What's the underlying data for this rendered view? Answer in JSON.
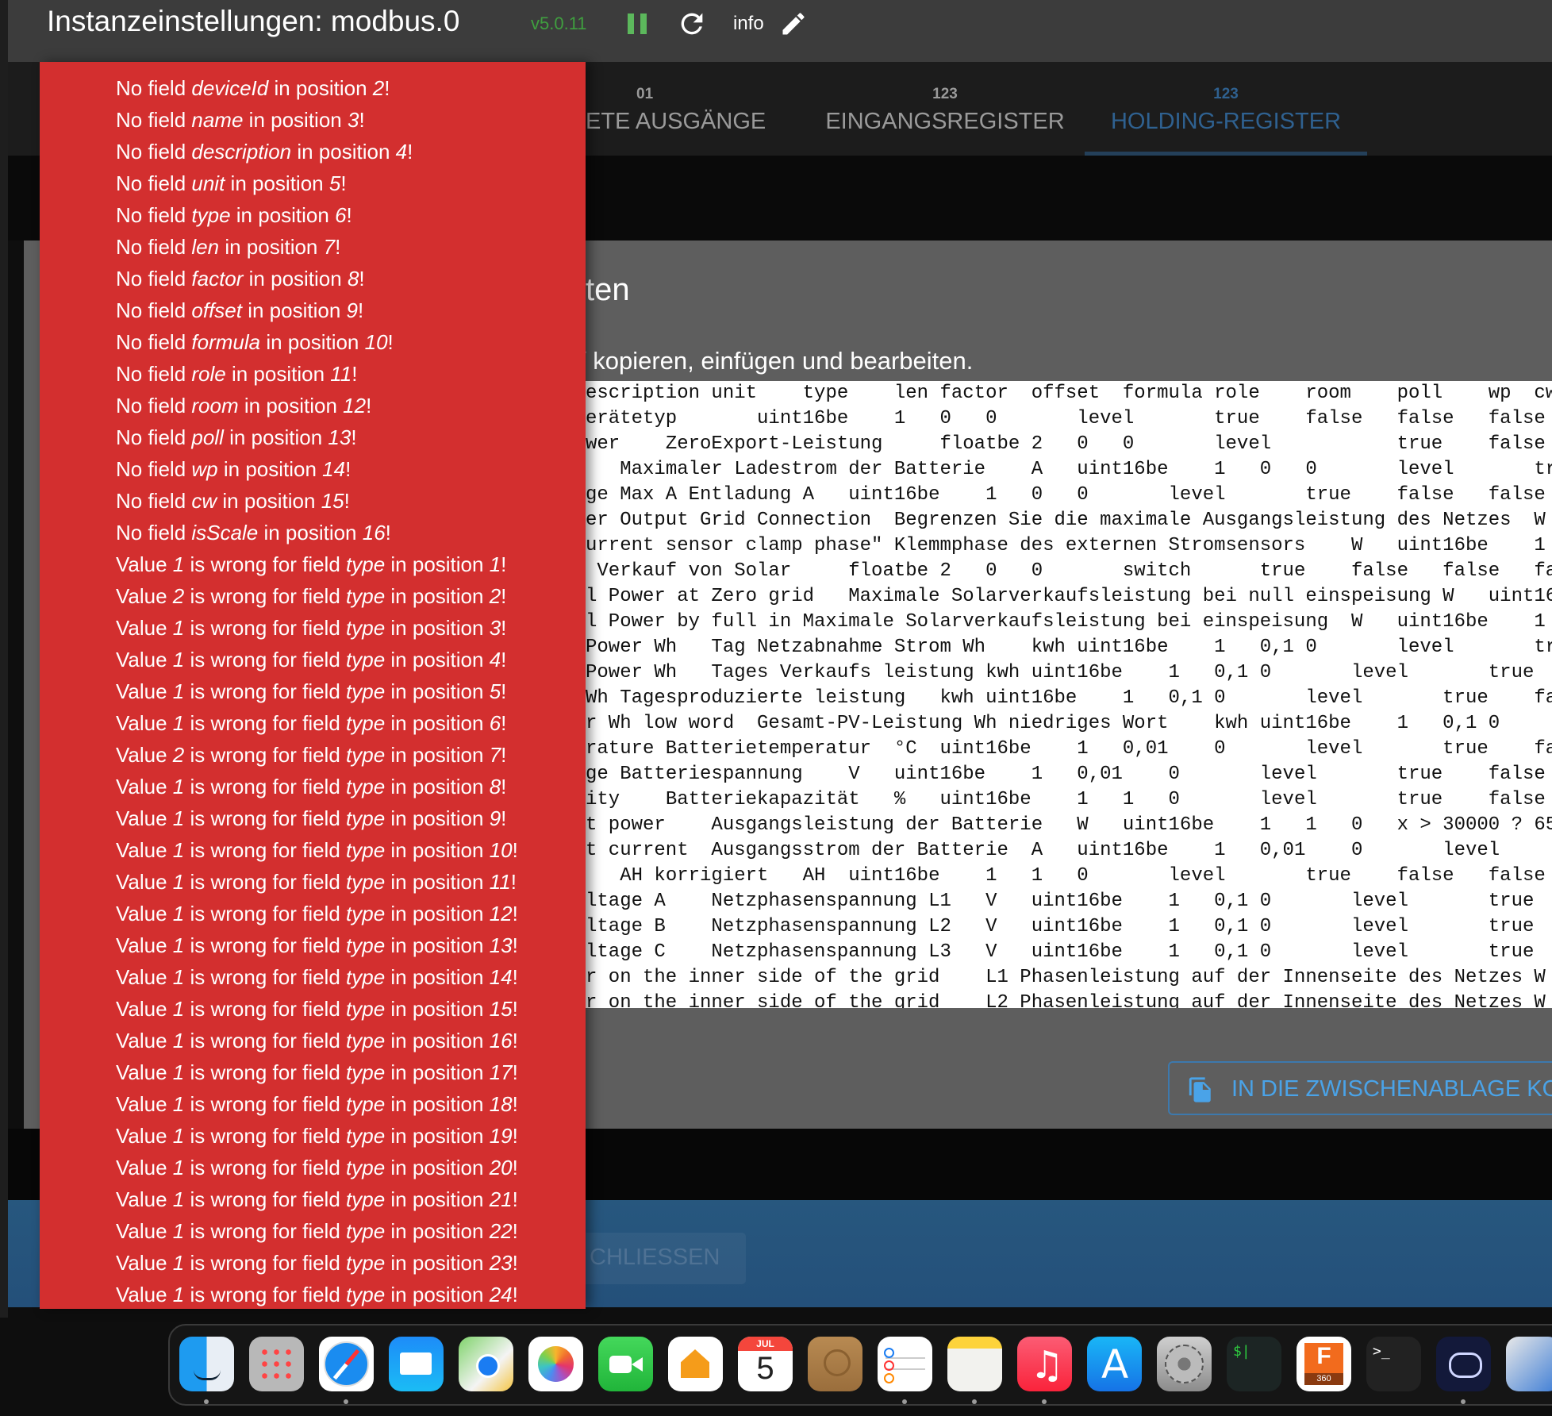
{
  "header": {
    "title": "Instanzeinstellungen: modbus.0",
    "version": "v5.0.11",
    "info_label": "info",
    "version_color": "#3f9f3f",
    "pause_color": "#5cb85c"
  },
  "tabs": [
    {
      "small": "01",
      "label": "ETE AUSGÄNGE",
      "active": false
    },
    {
      "small": "123",
      "label": "EINGANGSREGISTER",
      "active": false
    },
    {
      "small": "123",
      "label": "HOLDING-REGISTER",
      "active": true
    }
  ],
  "dialog": {
    "title": "ten",
    "subtitle": "/ kopieren, einfügen und bearbeiten.",
    "copy_button": "IN DIE ZWISCHENABLAGE KO",
    "close_button": "CHLIESSEN",
    "tsv_lines": [
      "escription unit\ttype\tlen factor\toffset\tformula\trole\troom\tpoll\twp\tcw",
      "erätetyp\t\tuint16be\t1\t0\t0\t\tlevel\t\ttrue\tfalse\tfalse\tfalse",
      "wer\tZeroExport-Leistung\t\tfloatbe\t2\t0\t0\t\tlevel\t\t\ttrue\tfalse\tfa",
      "\tMaximaler Ladestrom der Batterie\tA\tuint16be\t1\t0\t0\t\tlevel\t\ttr",
      "ge Max A Entladung A\tuint16be\t1\t0\t0\t\tlevel\t\ttrue\tfalse\tfalse",
      "er Output Grid Connection\tBegrenzen Sie die maximale Ausgangsleistung des Netzes\tW",
      "urrent sensor clamp phase\" Klemmphase des externen Stromsensors\tW\tuint16be\t1",
      " Verkauf von Solar\t\tfloatbe\t2\t0\t0\t\tswitch\t\ttrue\tfalse\tfalse\tfa",
      "l Power at Zero grid\tMaximale Solarverkaufsleistung bei null einspeisung\tW\tuint16",
      "l Power by full in Maximale Solarverkaufsleistung bei einspeisung\tW\tuint16be\t1",
      "Power Wh\tTag Netzabnahme Strom Wh\tkwh\tuint16be\t1\t0,1\t0\t\tlevel\t\ttr",
      "Power Wh\tTages Verkaufs leistung\tkwh\tuint16be\t1\t0,1\t0\t\tlevel\t\ttrue",
      "Wh\tTagesproduzierte leistung\tkwh\tuint16be\t1\t0,1\t0\t\tlevel\t\ttrue\tfa",
      "r Wh low word\tGesamt-PV-Leistung Wh niedriges Wort\tkwh\tuint16be\t1\t0,1\t0",
      "rature Batterietemperatur\t°C\tuint16be\t1\t0,01\t0\t\tlevel\t\ttrue\tfa",
      "ge\tBatteriespannung\tV\tuint16be\t1\t0,01\t0\t\tlevel\t\ttrue\tfalse",
      "ity\tBatteriekapazität\t%\tuint16be\t1\t1\t0\t\tlevel\t\ttrue\tfalse",
      "t power\tAusgangsleistung der Batterie\tW\tuint16be\t1\t1\t0\tx > 30000 ? 65",
      "t current\tAusgangsstrom der Batterie\tA\tuint16be\t1\t0,01\t0\t\tlevel",
      "\tAH korrigiert\tAH\tuint16be\t1\t1\t0\t\tlevel\t\ttrue\tfalse\tfalse",
      "ltage A\tNetzphasenspannung L1\tV\tuint16be\t1\t0,1\t0\t\tlevel\t\ttrue",
      "ltage B\tNetzphasenspannung L2\tV\tuint16be\t1\t0,1\t0\t\tlevel\t\ttrue",
      "ltage C\tNetzphasenspannung L3\tV\tuint16be\t1\t0,1\t0\t\tlevel\t\ttrue",
      "r on the inner side of the grid\tL1 Phasenleistung auf der Innenseite des Netzes\tW",
      "r on the inner side of the grid\tL2 Phasenleistung auf der Innenseite des Netzes\tW"
    ]
  },
  "errors": {
    "color": "#d32f2f",
    "missing_fields": [
      {
        "field": "deviceId",
        "position": "2"
      },
      {
        "field": "name",
        "position": "3"
      },
      {
        "field": "description",
        "position": "4"
      },
      {
        "field": "unit",
        "position": "5"
      },
      {
        "field": "type",
        "position": "6"
      },
      {
        "field": "len",
        "position": "7"
      },
      {
        "field": "factor",
        "position": "8"
      },
      {
        "field": "offset",
        "position": "9"
      },
      {
        "field": "formula",
        "position": "10"
      },
      {
        "field": "role",
        "position": "11"
      },
      {
        "field": "room",
        "position": "12"
      },
      {
        "field": "poll",
        "position": "13"
      },
      {
        "field": "wp",
        "position": "14"
      },
      {
        "field": "cw",
        "position": "15"
      },
      {
        "field": "isScale",
        "position": "16"
      }
    ],
    "wrong_values": [
      {
        "value": "1",
        "field": "type",
        "position": "1"
      },
      {
        "value": "2",
        "field": "type",
        "position": "2"
      },
      {
        "value": "1",
        "field": "type",
        "position": "3"
      },
      {
        "value": "1",
        "field": "type",
        "position": "4"
      },
      {
        "value": "1",
        "field": "type",
        "position": "5"
      },
      {
        "value": "1",
        "field": "type",
        "position": "6"
      },
      {
        "value": "2",
        "field": "type",
        "position": "7"
      },
      {
        "value": "1",
        "field": "type",
        "position": "8"
      },
      {
        "value": "1",
        "field": "type",
        "position": "9"
      },
      {
        "value": "1",
        "field": "type",
        "position": "10"
      },
      {
        "value": "1",
        "field": "type",
        "position": "11"
      },
      {
        "value": "1",
        "field": "type",
        "position": "12"
      },
      {
        "value": "1",
        "field": "type",
        "position": "13"
      },
      {
        "value": "1",
        "field": "type",
        "position": "14"
      },
      {
        "value": "1",
        "field": "type",
        "position": "15"
      },
      {
        "value": "1",
        "field": "type",
        "position": "16"
      },
      {
        "value": "1",
        "field": "type",
        "position": "17"
      },
      {
        "value": "1",
        "field": "type",
        "position": "18"
      },
      {
        "value": "1",
        "field": "type",
        "position": "19"
      },
      {
        "value": "1",
        "field": "type",
        "position": "20"
      },
      {
        "value": "1",
        "field": "type",
        "position": "21"
      },
      {
        "value": "1",
        "field": "type",
        "position": "22"
      },
      {
        "value": "1",
        "field": "type",
        "position": "23"
      },
      {
        "value": "1",
        "field": "type",
        "position": "24"
      }
    ],
    "text": {
      "no_field": "No field ",
      "in_position": " in position ",
      "value": "Value ",
      "is_wrong": " is wrong for field ",
      "end": "!"
    }
  },
  "dock": {
    "items": [
      {
        "icon": "finder-icon",
        "bg": "linear-gradient(90deg,#1e9bf0 50%,#e8eef5 50%)",
        "running": true
      },
      {
        "icon": "launchpad-icon",
        "bg": "#b8b8b8",
        "running": false
      },
      {
        "icon": "safari-icon",
        "bg": "#ffffff",
        "running": true
      },
      {
        "icon": "mail-icon",
        "bg": "linear-gradient(#1d8cf8,#1bbcf5)",
        "running": false
      },
      {
        "icon": "maps-icon",
        "bg": "linear-gradient(135deg,#7fd36b,#f4f4f4 60%,#f5c542)",
        "running": false
      },
      {
        "icon": "photos-icon",
        "bg": "#ffffff",
        "running": false
      },
      {
        "icon": "facetime-icon",
        "bg": "linear-gradient(#44d85b,#21b53a)",
        "running": false
      },
      {
        "icon": "home-icon",
        "bg": "#ffffff",
        "running": false
      },
      {
        "icon": "calendar-icon",
        "bg": "#ffffff",
        "running": false,
        "month": "JUL",
        "day": "5"
      },
      {
        "icon": "contacts-icon",
        "bg": "linear-gradient(#b88a52,#9a6e3c)",
        "running": false
      },
      {
        "icon": "reminders-icon",
        "bg": "#ffffff",
        "running": true
      },
      {
        "icon": "notes-icon",
        "bg": "linear-gradient(#fdd33b 22%,#f2f2ee 22%)",
        "running": true
      },
      {
        "icon": "music-icon",
        "bg": "linear-gradient(#fb5c74,#fa233b)",
        "running": true
      },
      {
        "icon": "app-store-icon",
        "bg": "linear-gradient(#19b6f7,#1673e6)",
        "running": false
      },
      {
        "icon": "system-settings-icon",
        "bg": "linear-gradient(#cfcfcf,#8c8c8c)",
        "running": false
      },
      {
        "icon": "terminal-green-icon",
        "bg": "#1c2524",
        "running": false
      },
      {
        "icon": "fusion-360-icon",
        "bg": "#ffffff",
        "running": false,
        "logo": "F",
        "logo_sub": "360"
      },
      {
        "icon": "terminal-icon",
        "bg": "#222222",
        "running": false
      },
      {
        "icon": "cloud-app-icon",
        "bg": "#13193a",
        "running": true
      },
      {
        "icon": "app-icon",
        "bg": "linear-gradient(135deg,#e8e8e8,#3a7bd5)",
        "running": false
      }
    ]
  }
}
